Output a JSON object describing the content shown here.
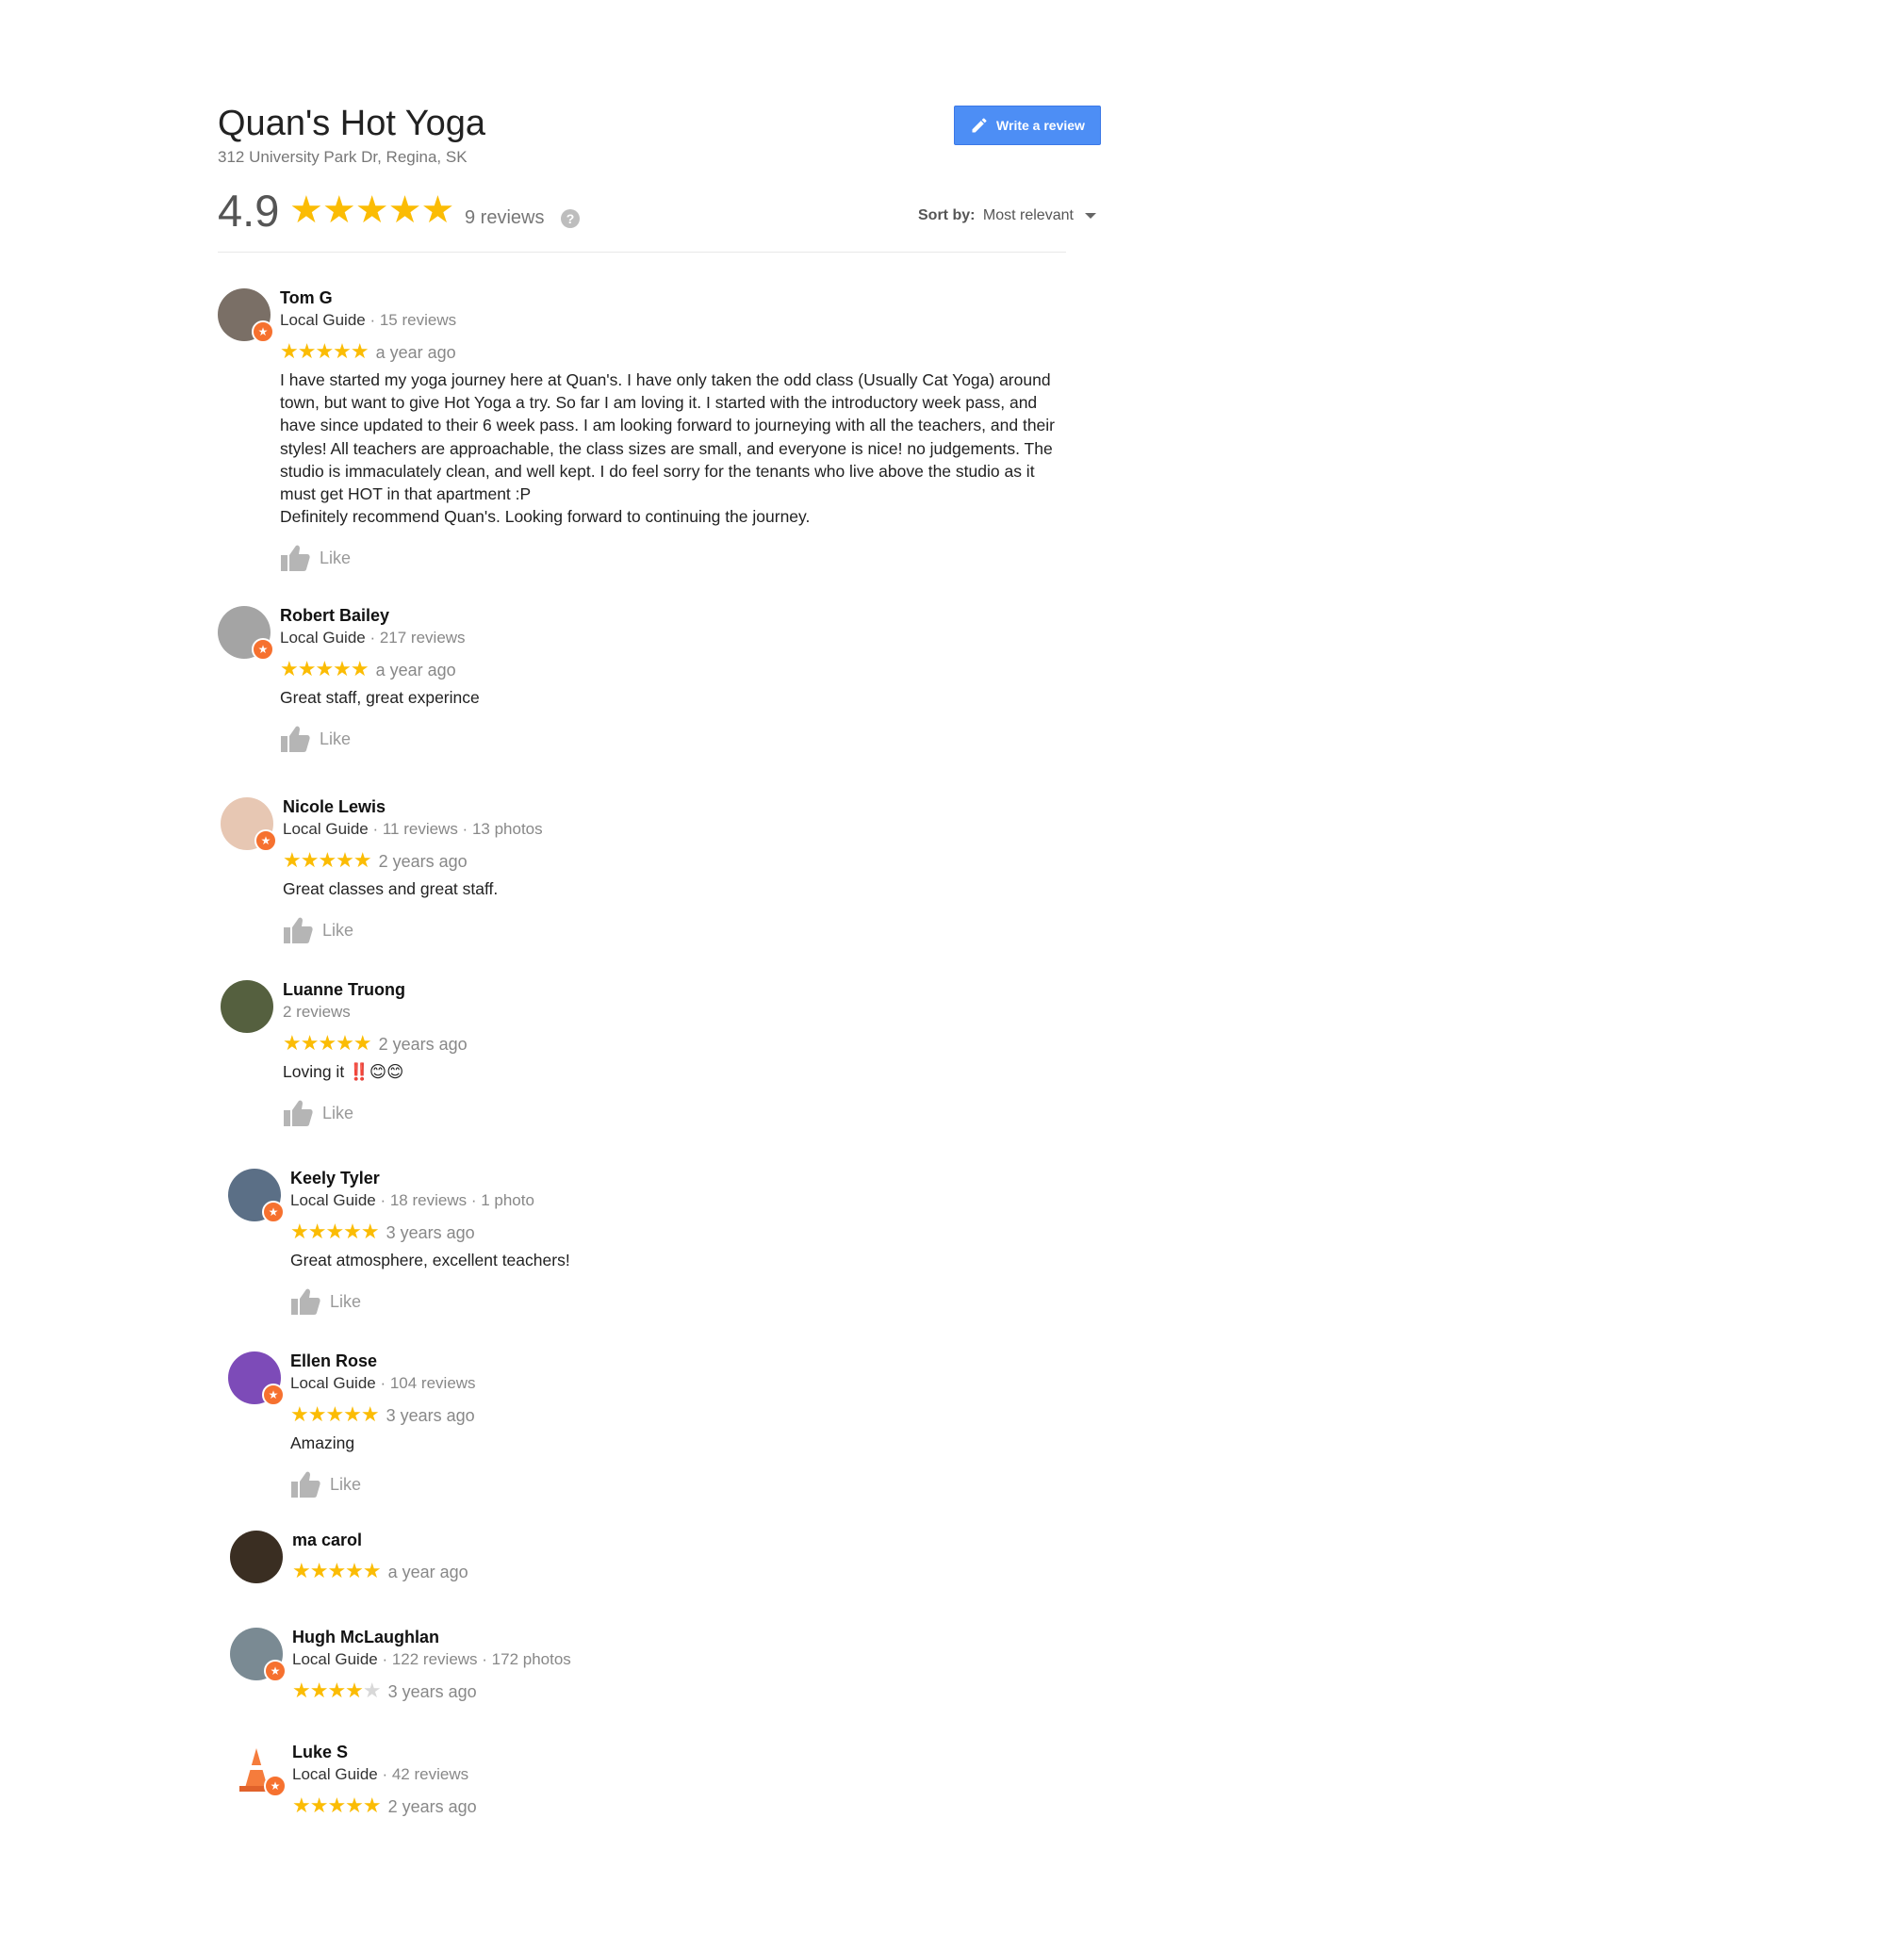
{
  "business": {
    "name": "Quan's Hot Yoga",
    "address": "312 University Park Dr, Regina, SK",
    "rating": "4.9",
    "stars": "★★★★★",
    "review_count": "9 reviews",
    "help_icon": "?"
  },
  "write_review": {
    "label": "Write a review",
    "icon": "pencil-icon",
    "color": "#4d8ef5"
  },
  "sort": {
    "label": "Sort by:",
    "value": "Most relevant"
  },
  "like_label": "Like",
  "star_color": "#fbbc04",
  "badge_color": "#f6712f",
  "reviews": [
    {
      "name": "Tom G",
      "guide": "Local Guide",
      "stats": " · 15 reviews",
      "stars_full": "★★★★★",
      "stars_empty": "",
      "rating": 5,
      "time": "a year ago",
      "text": "I have started my yoga journey here at Quan's. I have only taken the odd class (Usually Cat Yoga) around town, but want to give Hot Yoga a try. So far I am loving it. I started with the introductory week pass, and have since updated to their 6 week pass. I am looking forward to journeying with all the teachers, and their styles! All teachers are approachable, the class sizes are small, and everyone is nice! no judgements. The studio is immaculately clean, and well kept. I do feel sorry for the tenants who live above the studio as it must get HOT in that apartment :P\nDefinitely recommend Quan's. Looking forward to continuing the journey.",
      "avatar_color": "#7a6f66"
    },
    {
      "name": "Robert Bailey",
      "guide": "Local Guide",
      "stats": " · 217 reviews",
      "stars_full": "★★★★★",
      "stars_empty": "",
      "rating": 5,
      "time": "a year ago",
      "text": "Great staff, great experince",
      "avatar_color": "#a4a4a4"
    },
    {
      "name": "Nicole Lewis",
      "guide": "Local Guide",
      "stats": " · 11 reviews · 13 photos",
      "stars_full": "★★★★★",
      "stars_empty": "",
      "rating": 5,
      "time": "2 years ago",
      "text": "Great classes and great staff.",
      "avatar_color": "#e7c7b3"
    },
    {
      "name": "Luanne Truong",
      "guide": "",
      "stats": "2 reviews",
      "stars_full": "★★★★★",
      "stars_empty": "",
      "rating": 5,
      "time": "2 years ago",
      "text": "Loving it ‼️😊😊",
      "avatar_color": "#55603f"
    },
    {
      "name": "Keely Tyler",
      "guide": "Local Guide",
      "stats": " · 18 reviews · 1 photo",
      "stars_full": "★★★★★",
      "stars_empty": "",
      "rating": 5,
      "time": "3 years ago",
      "text": "Great atmosphere, excellent teachers!",
      "avatar_color": "#5b6f86"
    },
    {
      "name": "Ellen Rose",
      "guide": "Local Guide",
      "stats": " · 104 reviews",
      "stars_full": "★★★★★",
      "stars_empty": "",
      "rating": 5,
      "time": "3 years ago",
      "text": "Amazing",
      "avatar_color": "#7d4bb8"
    },
    {
      "name": "ma carol",
      "guide": "",
      "stats": "",
      "stars_full": "★★★★★",
      "stars_empty": "",
      "rating": 5,
      "time": "a year ago",
      "text": "",
      "avatar_color": "#3a2e22"
    },
    {
      "name": "Hugh McLaughlan",
      "guide": "Local Guide",
      "stats": " · 122 reviews · 172 photos",
      "stars_full": "★★★★",
      "stars_empty": "★",
      "rating": 4,
      "time": "3 years ago",
      "text": "",
      "avatar_color": "#7a8a93"
    },
    {
      "name": "Luke S",
      "guide": "Local Guide",
      "stats": " · 42 reviews",
      "stars_full": "★★★★★",
      "stars_empty": "",
      "rating": 5,
      "time": "2 years ago",
      "text": "",
      "avatar_color": "#ffffff"
    }
  ]
}
